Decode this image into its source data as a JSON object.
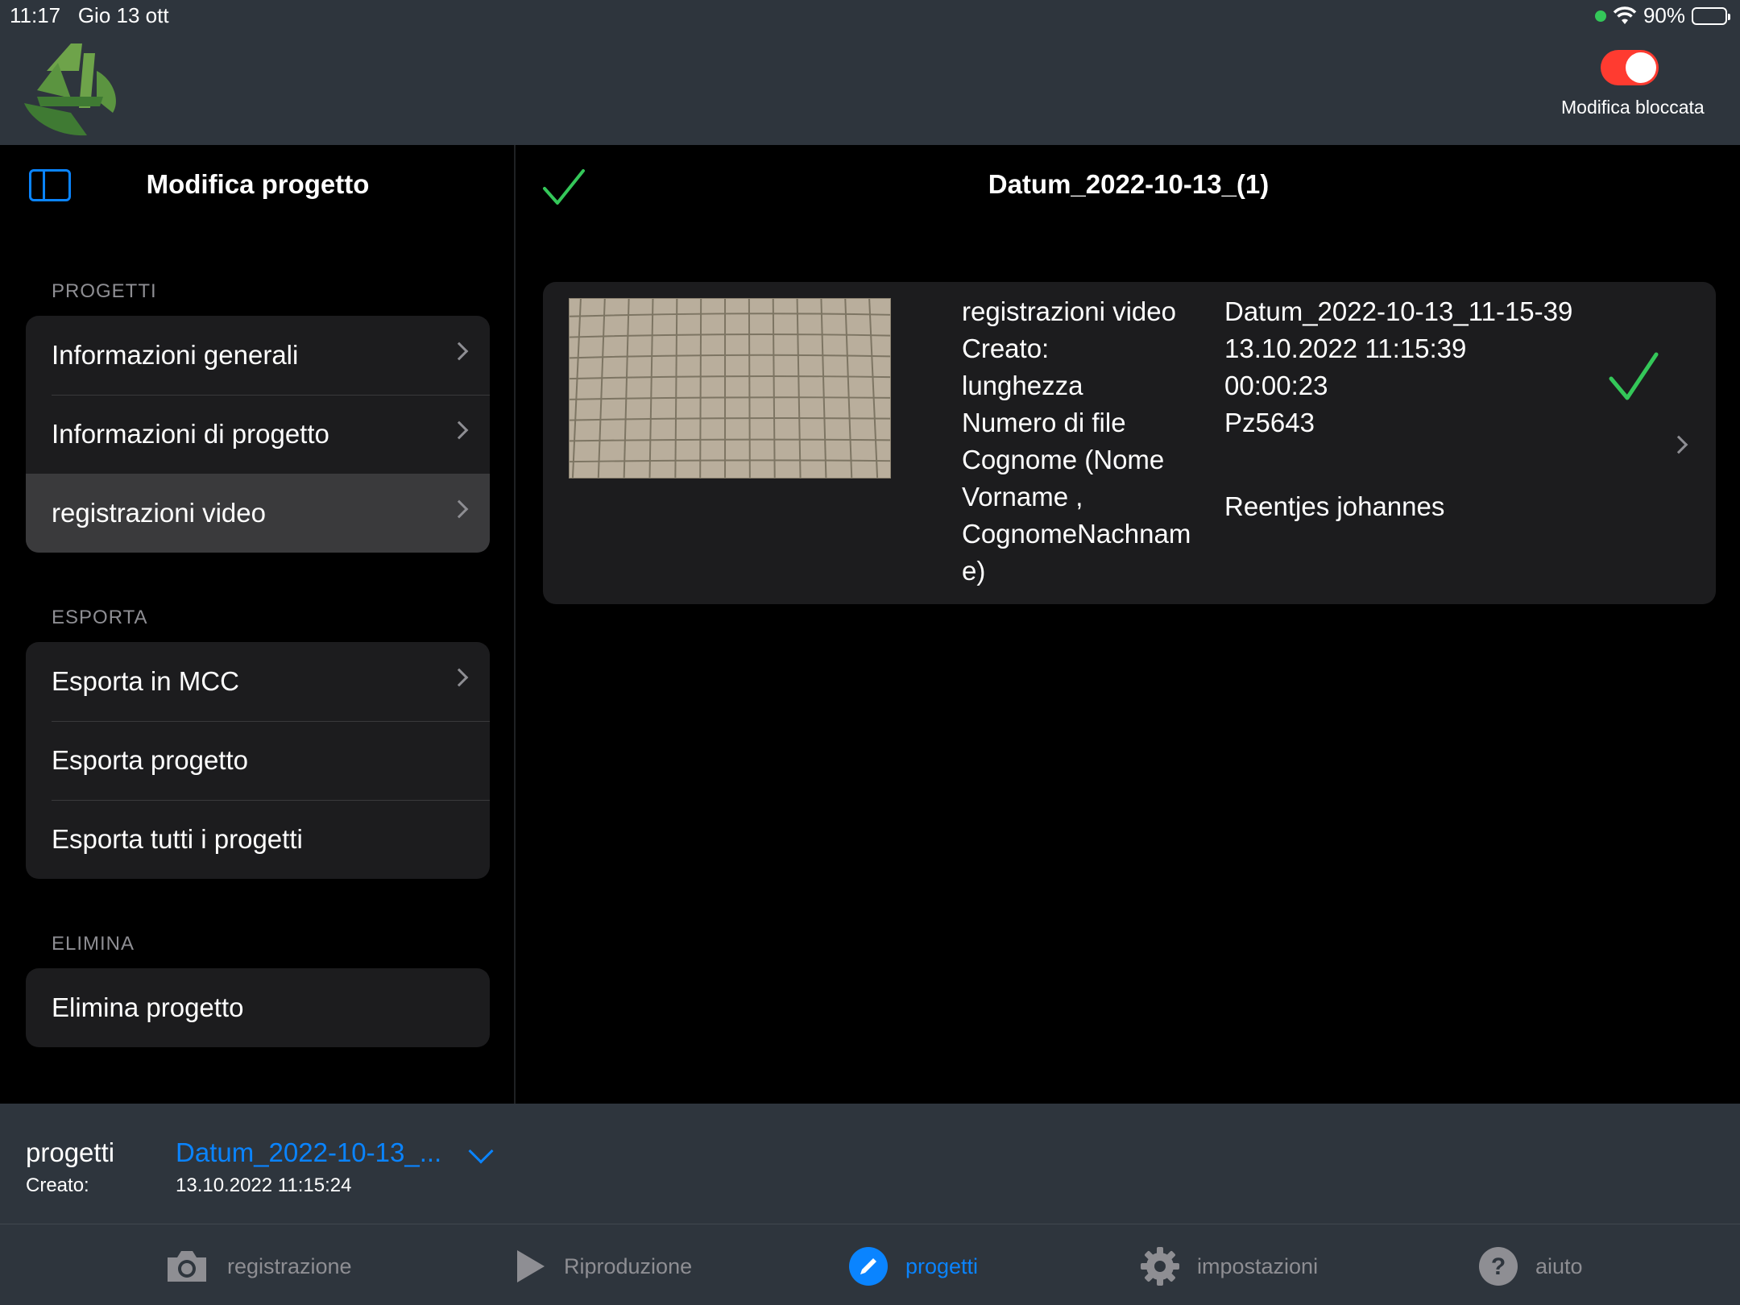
{
  "status": {
    "time": "11:17",
    "date": "Gio 13 ott",
    "battery": "90%"
  },
  "header": {
    "toggle_label": "Modifica bloccata",
    "toggle_on": true,
    "accent": "#ff3b30"
  },
  "sidebar": {
    "title": "Modifica progetto",
    "sections": [
      {
        "label": "PROGETTI",
        "items": [
          {
            "label": "Informazioni generali"
          },
          {
            "label": "Informazioni di progetto"
          },
          {
            "label": "registrazioni video",
            "selected": true
          }
        ]
      },
      {
        "label": "ESPORTA",
        "items": [
          {
            "label": "Esporta in MCC"
          },
          {
            "label": "Esporta progetto"
          },
          {
            "label": "Esporta tutti i progetti"
          }
        ]
      },
      {
        "label": "ELIMINA",
        "items": [
          {
            "label": "Elimina progetto"
          }
        ]
      }
    ]
  },
  "detail": {
    "title": "Datum_2022-10-13_(1)",
    "card": {
      "labels": [
        "registrazioni video",
        "Creato:",
        "lunghezza",
        "Numero di file",
        "Cognome (Nome",
        "Vorname ,",
        "CognomeNachnam",
        "e)"
      ],
      "values": [
        "Datum_2022-10-13_11-15-39",
        "13.10.2022 11:15:39",
        "00:00:23",
        "Pz5643",
        "",
        "Reentjes johannes"
      ]
    }
  },
  "projbar": {
    "label": "progetti",
    "created_label": "Creato:",
    "project_name": "Datum_2022-10-13_...",
    "created_date": "13.10.2022 11:15:24"
  },
  "tabs": [
    {
      "label": "registrazione",
      "icon": "camera-icon"
    },
    {
      "label": "Riproduzione",
      "icon": "play-icon"
    },
    {
      "label": "progetti",
      "icon": "pencil-icon",
      "active": true
    },
    {
      "label": "impostazioni",
      "icon": "gear-icon"
    },
    {
      "label": "aiuto",
      "icon": "help-icon"
    }
  ],
  "colors": {
    "accent": "#0a84ff",
    "check": "#34c759",
    "bar": "#2e353d"
  }
}
